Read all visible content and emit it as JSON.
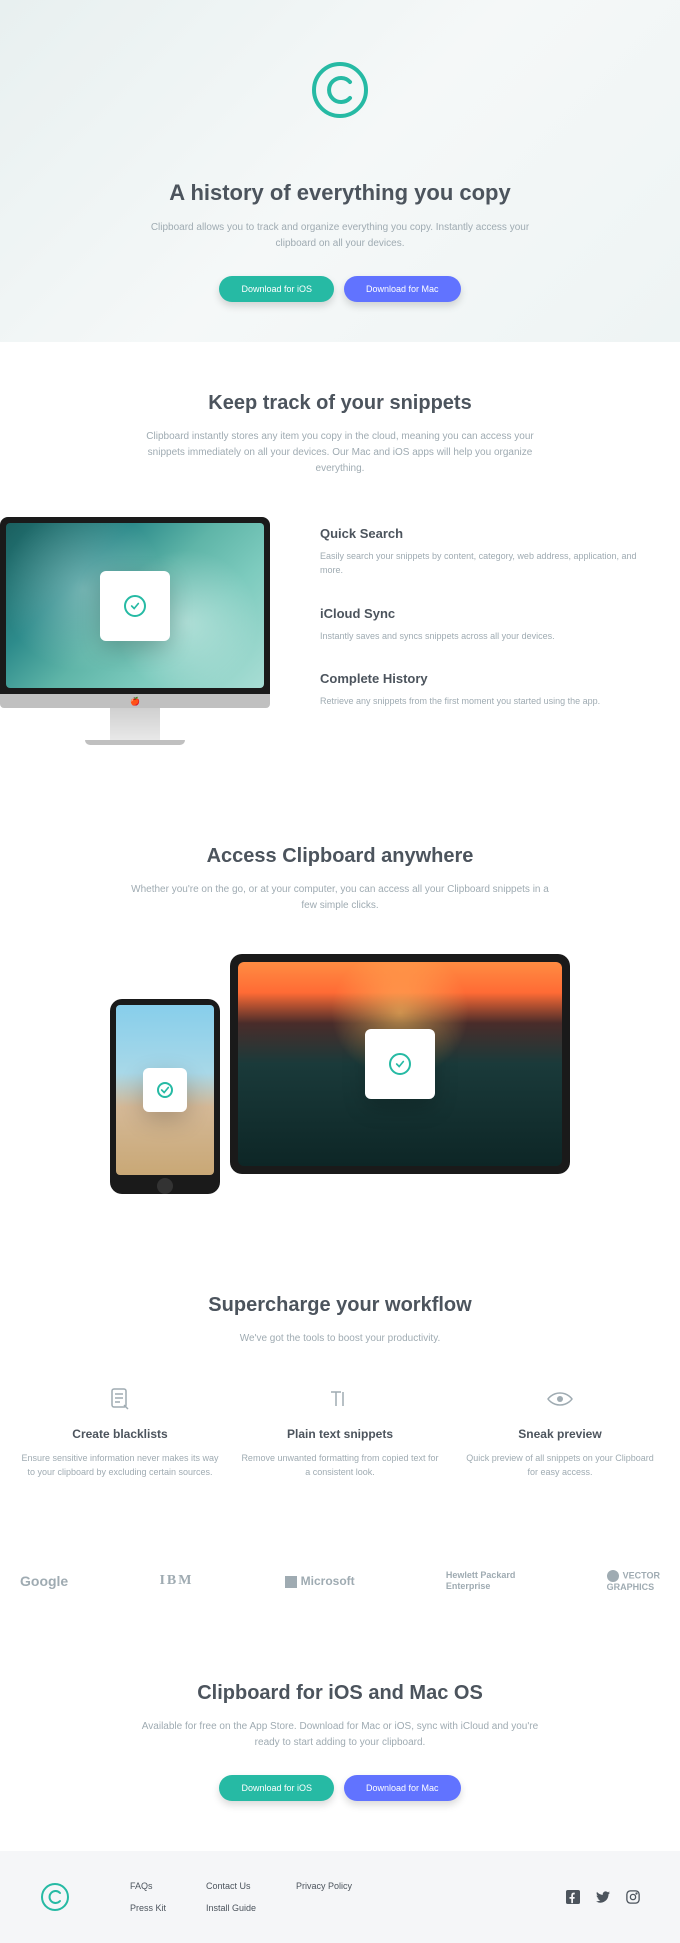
{
  "hero": {
    "title": "A history of everything you copy",
    "subtitle": "Clipboard allows you to track and organize everything you copy. Instantly access your clipboard on all your devices.",
    "btn_ios": "Download for iOS",
    "btn_mac": "Download for Mac"
  },
  "snippets": {
    "title": "Keep track of your snippets",
    "subtitle": "Clipboard instantly stores any item you copy in the cloud, meaning you can access your snippets immediately on all your devices. Our Mac and iOS apps will help you organize everything.",
    "features": [
      {
        "title": "Quick Search",
        "body": "Easily search your snippets by content, category, web address, application, and more."
      },
      {
        "title": "iCloud Sync",
        "body": "Instantly saves and syncs snippets across all your devices."
      },
      {
        "title": "Complete History",
        "body": "Retrieve any snippets from the first moment you started using the app."
      }
    ]
  },
  "access": {
    "title": "Access Clipboard anywhere",
    "subtitle": "Whether you're on the go, or at your computer, you can access all your Clipboard snippets in a few simple clicks."
  },
  "workflow": {
    "title": "Supercharge your workflow",
    "subtitle": "We've got the tools to boost your productivity.",
    "items": [
      {
        "title": "Create blacklists",
        "body": "Ensure sensitive information never makes its way to your clipboard by excluding certain sources."
      },
      {
        "title": "Plain text snippets",
        "body": "Remove unwanted formatting from copied text for a consistent look."
      },
      {
        "title": "Sneak preview",
        "body": "Quick preview of all snippets on your Clipboard for easy access."
      }
    ]
  },
  "brands": [
    "Google",
    "IBM",
    "Microsoft",
    "Hewlett Packard\nEnterprise",
    "VECTOR\nGRAPHICS"
  ],
  "cta": {
    "title": "Clipboard for iOS and Mac OS",
    "subtitle": "Available for free on the App Store. Download for Mac or iOS, sync with iCloud and you're ready to start adding to your clipboard.",
    "btn_ios": "Download for iOS",
    "btn_mac": "Download for Mac"
  },
  "footer": {
    "links": [
      "FAQs",
      "Contact Us",
      "Privacy Policy",
      "Press Kit",
      "Install Guide"
    ]
  }
}
